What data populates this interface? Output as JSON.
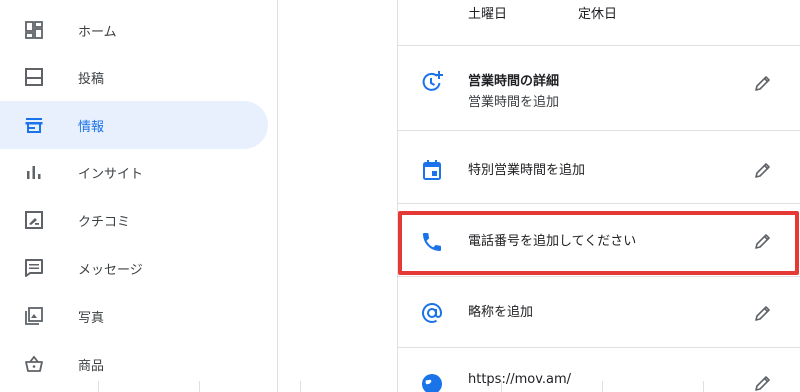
{
  "sidebar": {
    "items": [
      {
        "label": "ホーム",
        "icon": "dashboard-icon"
      },
      {
        "label": "投稿",
        "icon": "post-icon"
      },
      {
        "label": "情報",
        "icon": "storefront-icon",
        "active": true
      },
      {
        "label": "インサイト",
        "icon": "bar-chart-icon"
      },
      {
        "label": "クチコミ",
        "icon": "review-icon"
      },
      {
        "label": "メッセージ",
        "icon": "message-icon"
      },
      {
        "label": "写真",
        "icon": "photo-icon"
      },
      {
        "label": "商品",
        "icon": "basket-icon"
      }
    ]
  },
  "hours": {
    "day": "土曜日",
    "status": "定休日"
  },
  "details": {
    "hours_detail": {
      "title": "営業時間の詳細",
      "subtitle": "営業時間を追加"
    },
    "special_hours": {
      "title": "特別営業時間を追加"
    },
    "phone": {
      "title": "電話番号を追加してください"
    },
    "short_name": {
      "title": "略称を追加"
    },
    "website": {
      "title": "https://mov.am/"
    }
  },
  "colors": {
    "accent": "#1a73e8",
    "active_bg": "#e8f0fe",
    "highlight": "#e53935"
  }
}
